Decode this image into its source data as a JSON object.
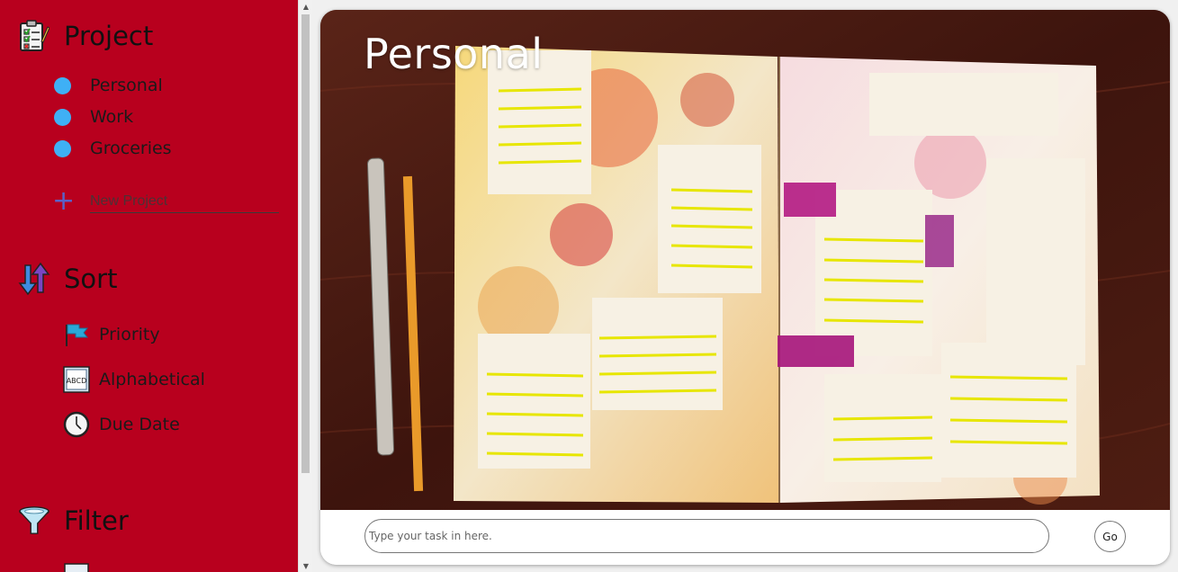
{
  "sidebar": {
    "project": {
      "title": "Project",
      "icon": "checklist-clipboard-icon",
      "items": [
        {
          "label": "Personal",
          "color": "#3fb0f5"
        },
        {
          "label": "Work",
          "color": "#3fb0f5"
        },
        {
          "label": "Groceries",
          "color": "#3fb0f5"
        }
      ],
      "new_project_placeholder": "New Project",
      "new_project_icon": "plus-icon"
    },
    "sort": {
      "title": "Sort",
      "icon": "sort-arrows-icon",
      "items": [
        {
          "label": "Priority",
          "icon": "flag-icon"
        },
        {
          "label": "Alphabetical",
          "icon": "abcd-icon",
          "icon_text": "ABCD"
        },
        {
          "label": "Due Date",
          "icon": "clock-icon"
        }
      ]
    },
    "filter": {
      "title": "Filter",
      "icon": "funnel-icon"
    }
  },
  "main": {
    "title": "Personal",
    "task_input_placeholder": "Type your task in here.",
    "go_label": "Go"
  },
  "colors": {
    "sidebar_bg": "#b8001e",
    "project_dot": "#3fb0f5",
    "accent": "#5a62c8"
  }
}
